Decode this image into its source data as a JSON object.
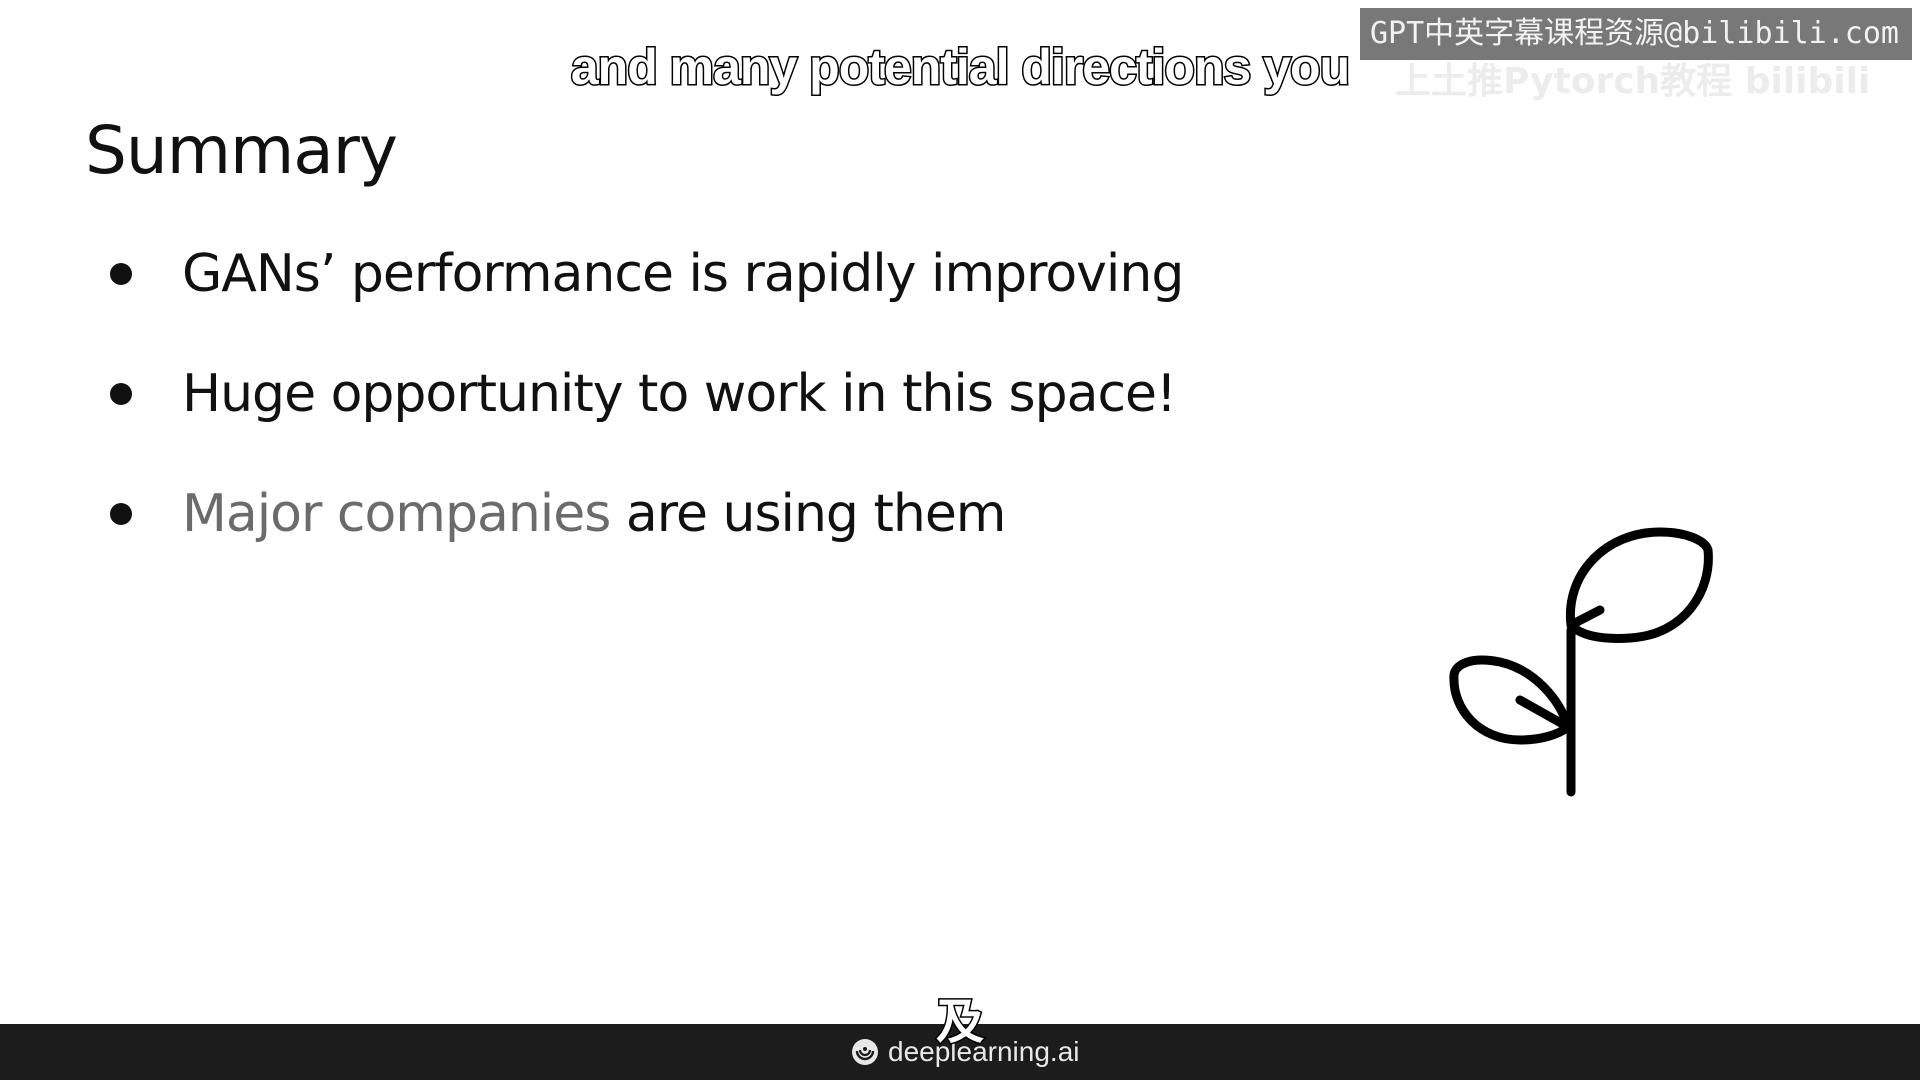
{
  "slide": {
    "title": "Summary",
    "bullets": [
      {
        "text": "GANs’ performance is rapidly improving"
      },
      {
        "text": "Huge opportunity to work in this space!"
      },
      {
        "text_muted": "Major companies",
        "text": " are using them"
      }
    ]
  },
  "subtitles": {
    "english": "and many potential directions you",
    "chinese": "及"
  },
  "watermark": {
    "text": "GPT中英字幕课程资源@bilibili.com",
    "ghost_text": "上土推Pytorch教程 bilibili"
  },
  "footer": {
    "brand": "deeplearning.ai"
  },
  "icons": {
    "plant": "sprout-icon",
    "logo": "deeplearning-logo-icon"
  },
  "colors": {
    "background": "#ffffff",
    "text": "#111111",
    "muted_text": "#6b6b6b",
    "footer_bg": "#1c1c1c"
  }
}
